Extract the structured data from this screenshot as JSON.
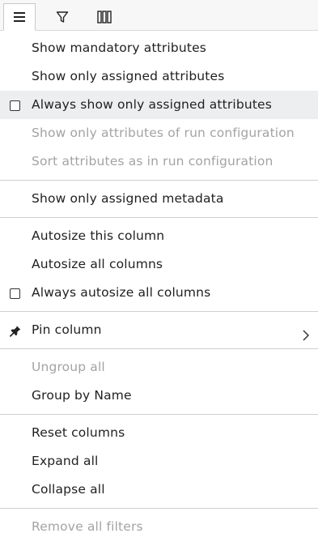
{
  "tabs": [
    {
      "icon": "menu-lines-icon",
      "active": true
    },
    {
      "icon": "filter-funnel-icon",
      "active": false
    },
    {
      "icon": "columns-icon",
      "active": false
    }
  ],
  "menu": {
    "group1": [
      {
        "label": "Show mandatory attributes",
        "disabled": false
      },
      {
        "label": "Show only assigned attributes",
        "disabled": false
      },
      {
        "label": "Always show only assigned attributes",
        "checkbox": true,
        "checked": false,
        "highlighted": true,
        "disabled": false
      },
      {
        "label": "Show only attributes of run configuration",
        "disabled": true
      },
      {
        "label": "Sort attributes as in run configuration",
        "disabled": true
      }
    ],
    "group2": [
      {
        "label": "Show only assigned metadata",
        "disabled": false
      }
    ],
    "group3": [
      {
        "label": "Autosize this column",
        "disabled": false
      },
      {
        "label": "Autosize all columns",
        "disabled": false
      },
      {
        "label": "Always autosize all columns",
        "checkbox": true,
        "checked": false,
        "disabled": false
      }
    ],
    "group4": [
      {
        "label": "Pin column",
        "icon": "pin-icon",
        "submenu": true,
        "disabled": false
      }
    ],
    "group5": [
      {
        "label": "Ungroup all",
        "disabled": true
      },
      {
        "label": "Group by Name",
        "disabled": false
      }
    ],
    "group6": [
      {
        "label": "Reset columns",
        "disabled": false
      },
      {
        "label": "Expand all",
        "disabled": false
      },
      {
        "label": "Collapse all",
        "disabled": false
      }
    ],
    "group7": [
      {
        "label": "Remove all filters",
        "disabled": true
      }
    ]
  },
  "colors": {
    "text": "#1f1f1f",
    "disabled_text": "#a3a3a3",
    "highlight": "#eceef0",
    "separator": "#cfcfcf"
  }
}
